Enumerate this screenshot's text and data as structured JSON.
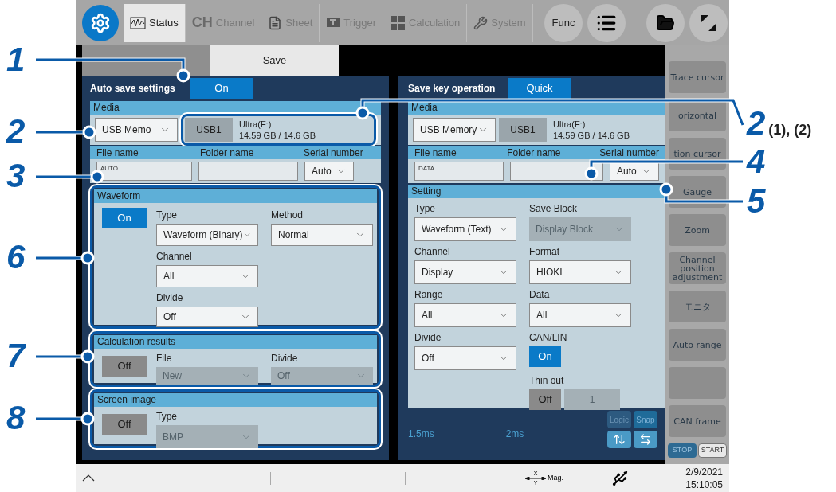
{
  "callouts": [
    {
      "label": "1"
    },
    {
      "label": "2"
    },
    {
      "label": "3"
    },
    {
      "label": "6"
    },
    {
      "label": "7"
    },
    {
      "label": "8"
    },
    {
      "label": "2",
      "note": "(1), (2)"
    },
    {
      "label": "4"
    },
    {
      "label": "5"
    }
  ],
  "toolbar": {
    "tabs": [
      {
        "kind": "status",
        "label": "Status",
        "selected": true
      },
      {
        "kind": "channel",
        "badge": "CH",
        "label": "Channel",
        "selected": false
      },
      {
        "kind": "sheet",
        "label": "Sheet",
        "selected": false
      },
      {
        "kind": "trigger",
        "label": "Trigger",
        "selected": false
      },
      {
        "kind": "calculation",
        "label": "Calculation",
        "selected": false
      },
      {
        "kind": "system",
        "label": "System",
        "selected": false
      }
    ],
    "func_button": "Func"
  },
  "view_tabs": [
    {
      "selected": false
    },
    {
      "label": "Save",
      "selected": true
    }
  ],
  "auto_save": {
    "title": "Auto save settings",
    "toggle": {
      "label": "On",
      "on": true
    },
    "media": {
      "header": "Media",
      "device": "USB Memo",
      "port": "USB1",
      "drive": "Ultra(F:)",
      "capacity": "14.59 GB / 14.6 GB"
    },
    "file": {
      "file_label": "File name",
      "folder_label": "Folder name",
      "serial_label": "Serial number",
      "file_name": "AUTO",
      "serial": "Auto"
    },
    "waveform": {
      "header": "Waveform",
      "toggle": {
        "label": "On",
        "on": true
      },
      "type_label": "Type",
      "type": "Waveform (Binary)",
      "method_label": "Method",
      "method": "Normal",
      "channel_label": "Channel",
      "channel": "All",
      "divide_label": "Divide",
      "divide": "Off"
    },
    "calculation": {
      "header": "Calculation results",
      "toggle": {
        "label": "Off",
        "on": false
      },
      "file_label": "File",
      "file": {
        "value": "New",
        "disabled": true
      },
      "divide_label": "Divide",
      "divide": {
        "value": "Off",
        "disabled": true
      }
    },
    "screen_image": {
      "header": "Screen image",
      "toggle": {
        "label": "Off",
        "on": false
      },
      "type_label": "Type",
      "type": {
        "value": "BMP",
        "disabled": true
      }
    }
  },
  "save_key": {
    "title": "Save key operation",
    "mode": {
      "label": "Quick",
      "on": true
    },
    "media": {
      "header": "Media",
      "device": "USB Memory",
      "port": "USB1",
      "drive": "Ultra(F:)",
      "capacity": "14.59 GB / 14.6 GB"
    },
    "file": {
      "file_label": "File name",
      "folder_label": "Folder name",
      "serial_label": "Serial number",
      "file_name": "DATA",
      "serial": "Auto"
    },
    "setting": {
      "header": "Setting",
      "fields": [
        {
          "label": "Type",
          "value": "Waveform (Text)",
          "disabled": false
        },
        {
          "label": "Save Block",
          "value": "Display Block",
          "disabled": true
        },
        {
          "label": "Channel",
          "value": "Display",
          "disabled": false
        },
        {
          "label": "Format",
          "value": "HIOKI",
          "disabled": false
        },
        {
          "label": "Range",
          "value": "All",
          "disabled": false
        },
        {
          "label": "Data",
          "value": "All",
          "disabled": false
        },
        {
          "label": "Divide",
          "value": "Off",
          "disabled": false
        }
      ],
      "can_lin": {
        "label": "CAN/LIN",
        "toggle": {
          "label": "On",
          "on": true
        }
      },
      "thin_out": {
        "label": "Thin out",
        "toggle": {
          "label": "Off",
          "on": false
        },
        "value": "1"
      }
    }
  },
  "graph": {
    "time_labels": [
      "1.5ms",
      "2ms"
    ],
    "logic": "Logic",
    "snap": "Snap"
  },
  "sidebar": {
    "items": [
      {
        "kind": "text",
        "label": "Trace cursor"
      },
      {
        "kind": "text",
        "label": "orizontal"
      },
      {
        "kind": "text",
        "label": "tion cursor"
      },
      {
        "kind": "text",
        "label": "Gauge"
      },
      {
        "kind": "text",
        "label": "Zoom"
      },
      {
        "kind": "text",
        "label": "Channel position adjustment"
      },
      {
        "kind": "text",
        "label": "モニタ"
      },
      {
        "kind": "text",
        "label": "Auto range"
      },
      {
        "kind": "blank"
      },
      {
        "kind": "text",
        "label": "CAN frame"
      }
    ],
    "stop": "STOP",
    "start": "START"
  },
  "status_bar": {
    "mag_x": "X",
    "mag_y": "Y",
    "mag_label": "Mag.",
    "date": "2/9/2021",
    "time": "15:10:05"
  }
}
